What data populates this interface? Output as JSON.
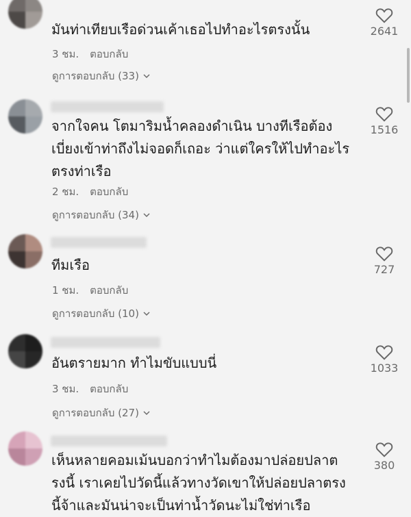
{
  "meta_labels": {
    "reply": "ตอบกลับ"
  },
  "comments": [
    {
      "text": "มันท่าเทียบเรือด่วนเค้าเธอไปทำอะไรตรงนั้น",
      "time": "3 ชม.",
      "view_replies": "ดูการตอบกลับ (33)",
      "likes": "2641"
    },
    {
      "text": "จากใจคน โตมาริมน้ำคลองดำเนิน บางทีเรือต้อง\nเบี่ยงเข้าท่าถึงไม่จอดก็เถอะ ว่าแต่ใครให้ไปทำอะไร\nตรงท่าเรือ",
      "time": "2 ชม.",
      "view_replies": "ดูการตอบกลับ (34)",
      "likes": "1516"
    },
    {
      "text": "ทีมเรือ",
      "time": "1 ชม.",
      "view_replies": "ดูการตอบกลับ (10)",
      "likes": "727"
    },
    {
      "text": "อันตรายมาก ทำไมขับแบบนี่",
      "time": "3 ชม.",
      "view_replies": "ดูการตอบกลับ (27)",
      "likes": "1033"
    },
    {
      "text": "เห็นหลายคอมเม้นบอกว่าทำไมต้องมาปล่อยปลาต\nรงนี้ เราเคยไปวัดนี้แล้วทางวัดเขาให้ปล่อยปลาตรง\nนี้จ้าและมันน่าจะเป็นท่าน้ำวัดนะไม่ใช่ท่าเรือ",
      "likes": "380"
    }
  ]
}
